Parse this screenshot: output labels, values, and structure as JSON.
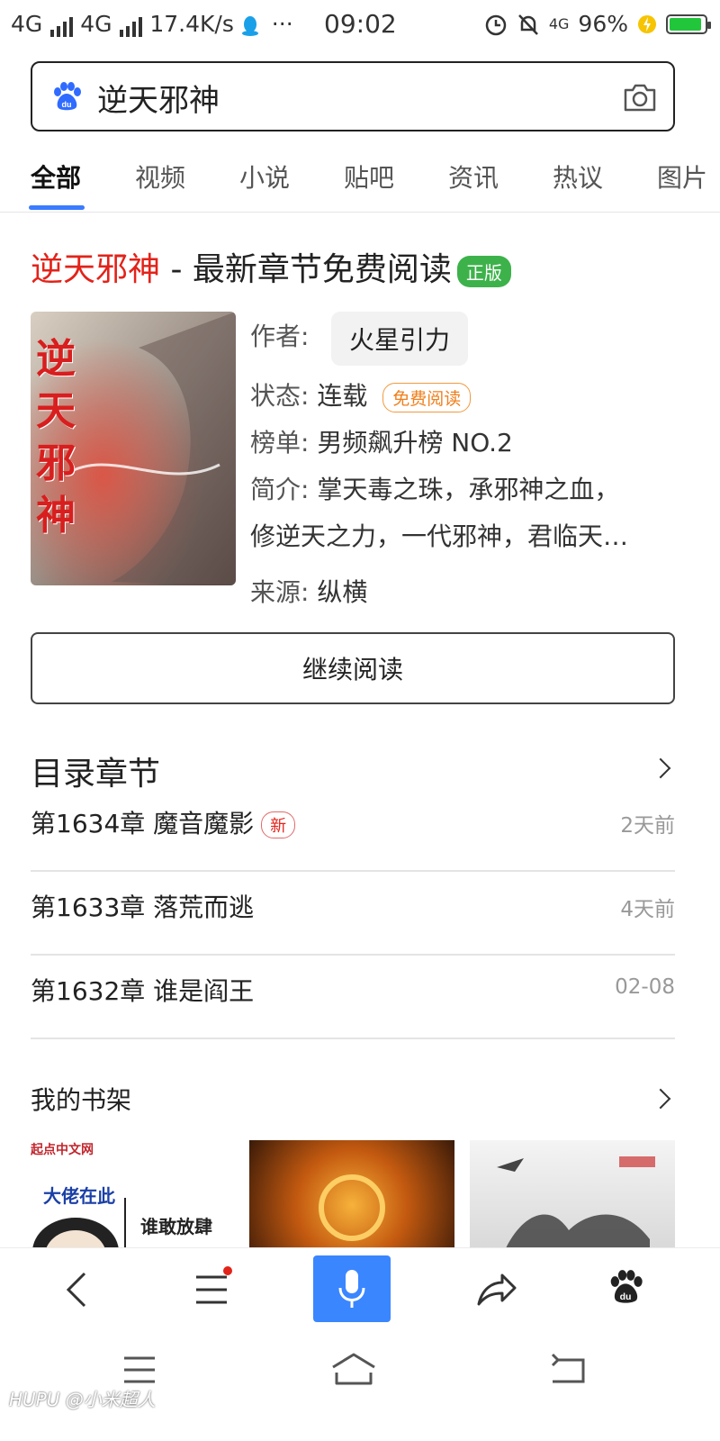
{
  "status_bar": {
    "network_left": "4G",
    "network_right": "4G",
    "speed": "17.4K/s",
    "dots": "···",
    "time": "09:02",
    "lte_badge": "4G",
    "battery": "96%",
    "battery_level": 0.96
  },
  "search": {
    "query": "逆天邪神"
  },
  "tabs": [
    {
      "label": "全部"
    },
    {
      "label": "视频"
    },
    {
      "label": "小说"
    },
    {
      "label": "贴吧"
    },
    {
      "label": "资讯"
    },
    {
      "label": "热议"
    },
    {
      "label": "图片"
    }
  ],
  "result": {
    "title_highlight": "逆天邪神",
    "title_rest": " - 最新章节免费阅读",
    "official_badge": "正版",
    "author_label": "作者:",
    "author": "火星引力",
    "status_label": "状态:",
    "status": "连载",
    "free_badge": "免费阅读",
    "rank_label": "榜单:",
    "rank": "男频飙升榜 NO.2",
    "intro_label": "简介:",
    "intro_line1": "掌天毒之珠，承邪神之血，",
    "intro_line2": "修逆天之力，一代邪神，君临天…",
    "source_label": "来源:",
    "source": "纵横",
    "continue_button": "继续阅读",
    "cover_text": "逆天邪神"
  },
  "toc": {
    "title": "目录章节",
    "chapters": [
      {
        "title": "第1634章 魔音魔影",
        "badge": "新",
        "time": "2天前"
      },
      {
        "title": "第1633章 落荒而逃",
        "badge": "",
        "time": "4天前"
      },
      {
        "title": "第1632章 谁是阎王",
        "badge": "",
        "time": "02-08"
      }
    ]
  },
  "shelf": {
    "title": "我的书架",
    "book1_publisher": "起点中文网",
    "book1_line1": "大佬在此",
    "book1_line2": "谁敢放肆"
  },
  "watermark": "HUPU @小米超人",
  "colors": {
    "accent_blue": "#3a86ff",
    "highlight_red": "#e2231a",
    "badge_green": "#3db24b",
    "badge_orange": "#f07f1c"
  }
}
